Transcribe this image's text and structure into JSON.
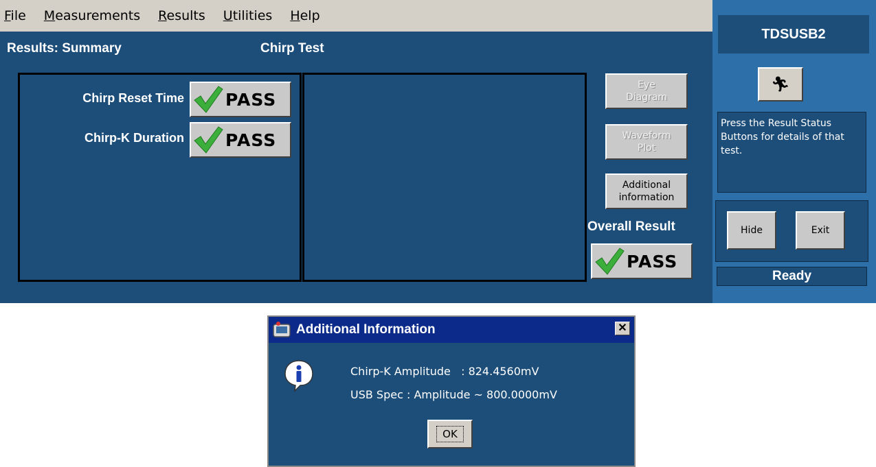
{
  "menu": {
    "items": [
      {
        "underline": "F",
        "rest": "ile"
      },
      {
        "underline": "M",
        "rest": "easurements"
      },
      {
        "underline": "R",
        "rest": "esults"
      },
      {
        "underline": "U",
        "rest": "tilities"
      },
      {
        "underline": "H",
        "rest": "elp"
      }
    ]
  },
  "header": {
    "section": "Results: Summary",
    "test": "Chirp Test"
  },
  "results": [
    {
      "label": "Chirp Reset Time",
      "status": "PASS"
    },
    {
      "label": "Chirp-K Duration",
      "status": "PASS"
    }
  ],
  "side_buttons": {
    "eye_diagram": {
      "line1": "Eye",
      "line2": "Diagram"
    },
    "waveform_plot": {
      "line1": "Waveform",
      "line2": "Plot"
    },
    "additional_info": {
      "line1": "Additional",
      "line2": "information"
    }
  },
  "overall": {
    "label": "Overall Result",
    "status": "PASS"
  },
  "right_panel": {
    "product": "TDSUSB2",
    "run_icon": "running-man-icon",
    "message": "Press the Result Status Buttons for details of that test.",
    "hide_label": "Hide",
    "exit_label": "Exit",
    "status": "Ready"
  },
  "dialog": {
    "title": "Additional Information",
    "close_label": "✕",
    "lines": [
      "Chirp-K Amplitude   : 824.4560mV",
      "USB Spec : Amplitude ~ 800.0000mV"
    ],
    "ok_label": "OK"
  },
  "colors": {
    "panel_blue": "#1d4e7a",
    "right_column_blue": "#2d6fa8",
    "dialog_titlebar": "#0b2a8a",
    "check_green": "#3cae3c"
  }
}
